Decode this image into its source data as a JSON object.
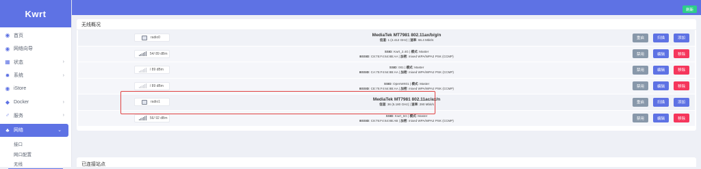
{
  "app": {
    "logo": "Kwrt"
  },
  "sidebar": {
    "items": [
      {
        "label": "首页",
        "icon": "gauge-icon",
        "chevron": false
      },
      {
        "label": "网络向导",
        "icon": "wand-icon",
        "chevron": false
      },
      {
        "label": "状态",
        "icon": "grid-icon",
        "chevron": true
      },
      {
        "label": "系统",
        "icon": "gear-icon",
        "chevron": true
      },
      {
        "label": "iStore",
        "icon": "store-icon",
        "chevron": false
      },
      {
        "label": "Docker",
        "icon": "docker-icon",
        "chevron": true
      },
      {
        "label": "服务",
        "icon": "services-icon",
        "chevron": true
      },
      {
        "label": "网络",
        "icon": "network-icon",
        "chevron": true,
        "active": true
      }
    ],
    "sub_items": [
      "接口",
      "网口配置",
      "无线"
    ]
  },
  "topbar": {
    "refresh_label": "刷新"
  },
  "wireless": {
    "title": "无线概况",
    "rows": [
      {
        "type": "radio",
        "name": "radio0",
        "title": "MediaTek MT7981 802.11ax/b/g/n",
        "line2": [
          [
            "信道",
            ": 1 (2.412 GHz) | "
          ],
          [
            "速率",
            ": 66.4 Mbit/s"
          ]
        ],
        "buttons": [
          "重启",
          "扫描",
          "添加"
        ]
      },
      {
        "type": "net",
        "signal": "54/ 89 dBm",
        "strong": true,
        "ssid_line": [
          [
            "SSID",
            ": Kwrt_2.4G | "
          ],
          [
            "模式",
            ": Master"
          ]
        ],
        "bssid_line": [
          [
            "BSSID",
            ": C8:75:F4:64:8B:AA | "
          ],
          [
            "加密",
            ": mixed WPA/WPA2 PSK (CCMP)"
          ]
        ],
        "buttons": [
          "禁用",
          "编辑",
          "移除"
        ]
      },
      {
        "type": "net",
        "signal": "/ 89 dBm",
        "strong": false,
        "ssid_line": [
          [
            "SSID",
            ": 001 | "
          ],
          [
            "模式",
            ": Master"
          ]
        ],
        "bssid_line": [
          [
            "BSSID",
            ": CA:75:F4:64:8B:AA | "
          ],
          [
            "加密",
            ": mixed WPA/WPA2 PSK (CCMP)"
          ]
        ],
        "buttons": [
          "禁用",
          "编辑",
          "移除"
        ]
      },
      {
        "type": "net",
        "signal": "/ 89 dBm",
        "strong": false,
        "ssid_line": [
          [
            "SSID",
            ": OpenWrt01 | "
          ],
          [
            "模式",
            ": Master"
          ]
        ],
        "bssid_line": [
          [
            "BSSID",
            ": CE:75:F4:64:8B:AA | "
          ],
          [
            "加密",
            ": mixed WPA/WPA2 PSK (CCMP)"
          ]
        ],
        "buttons": [
          "禁用",
          "编辑",
          "移除"
        ]
      },
      {
        "type": "radio",
        "name": "radio1",
        "title": "MediaTek MT7981 802.11ac/ax/n",
        "line2": [
          [
            "信道",
            ": 36 (5.180 GHz) | "
          ],
          [
            "速率",
            ": 290 Mbit/s"
          ]
        ],
        "buttons": [
          "重启",
          "扫描",
          "添加"
        ]
      },
      {
        "type": "net",
        "signal": "56/ 92 dBm",
        "strong": true,
        "ssid_line": [
          [
            "SSID",
            ": Kwrt_5G | "
          ],
          [
            "模式",
            ": Master"
          ]
        ],
        "bssid_line": [
          [
            "BSSID",
            ": C8:75:F4:64:8B:AB | "
          ],
          [
            "加密",
            ": mixed WPA/WPA2 PSK (CCMP)"
          ]
        ],
        "buttons": [
          "禁用",
          "编辑",
          "移除"
        ]
      }
    ]
  },
  "stations": {
    "title": "已连接站点"
  },
  "colors": {
    "accent": "#5e72e4",
    "green": "#2dce89",
    "red": "#f5365c",
    "gray": "#8898aa"
  }
}
